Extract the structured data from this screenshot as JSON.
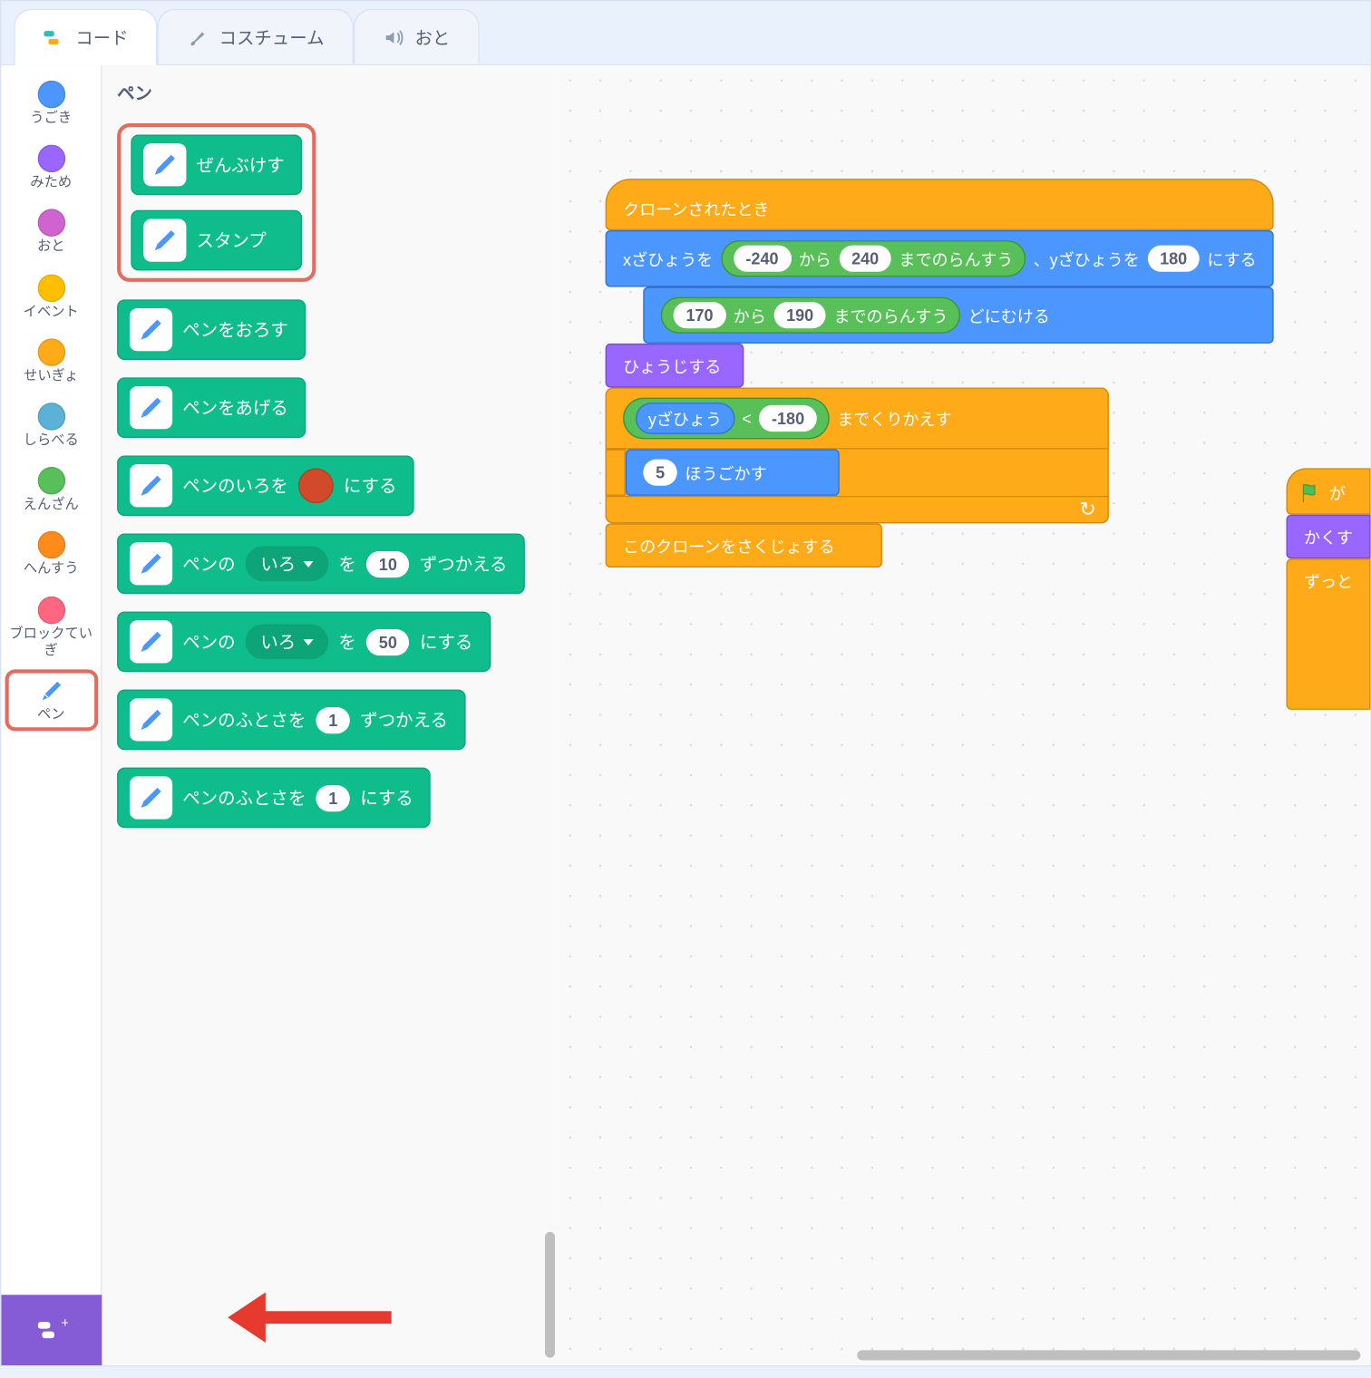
{
  "tabs": {
    "code": "コード",
    "costumes": "コスチューム",
    "sounds": "おと"
  },
  "categories": {
    "motion": "うごき",
    "looks": "みため",
    "sound": "おと",
    "events": "イベント",
    "control": "せいぎょ",
    "sensing": "しらべる",
    "operators": "えんざん",
    "variables": "へんすう",
    "myblocks": "ブロックていぎ",
    "pen": "ペン"
  },
  "category_colors": {
    "motion": "#4c97ff",
    "looks": "#9966ff",
    "sound": "#cf63cf",
    "events": "#ffbf00",
    "control": "#ffab19",
    "sensing": "#5cb1d6",
    "operators": "#59c059",
    "variables": "#ff8c1a",
    "myblocks": "#ff6680"
  },
  "palette": {
    "heading": "ペン",
    "blocks": {
      "erase_all": "ぜんぶけす",
      "stamp": "スタンプ",
      "pen_down": "ペンをおろす",
      "pen_up": "ペンをあげる",
      "set_color_pre": "ペンのいろを",
      "set_color_post": "にする",
      "change_attr_pre": "ペンの",
      "change_attr_drop": "いろ",
      "change_attr_mid": "を",
      "change_attr_val": "10",
      "change_attr_post": "ずつかえる",
      "set_attr_pre": "ペンの",
      "set_attr_drop": "いろ",
      "set_attr_mid": "を",
      "set_attr_val": "50",
      "set_attr_post": "にする",
      "change_size_pre": "ペンのふとさを",
      "change_size_val": "1",
      "change_size_post": "ずつかえる",
      "set_size_pre": "ペンのふとさを",
      "set_size_val": "1",
      "set_size_post": "にする"
    }
  },
  "script1": {
    "hat": "クローンされたとき",
    "goto_pre": "xざひょうを",
    "goto_r1a": "-240",
    "goto_r1mid": "から",
    "goto_r1b": "240",
    "goto_r1post": "までのらんすう",
    "goto_sep": "、yざひょうを",
    "goto_y": "180",
    "goto_post": "にする",
    "point_r_a": "170",
    "point_r_mid": "から",
    "point_r_b": "190",
    "point_r_post": "までのらんすう",
    "point_post": "どにむける",
    "show": "ひょうじする",
    "repeat_var": "yざひょう",
    "repeat_op": "<",
    "repeat_val": "-180",
    "repeat_post": "までくりかえす",
    "move_val": "5",
    "move_post": "ほうごかす",
    "delete_clone": "このクローンをさくじょする"
  },
  "script2": {
    "flag_post": "が",
    "hide": "かくす",
    "forever": "ずっと"
  }
}
